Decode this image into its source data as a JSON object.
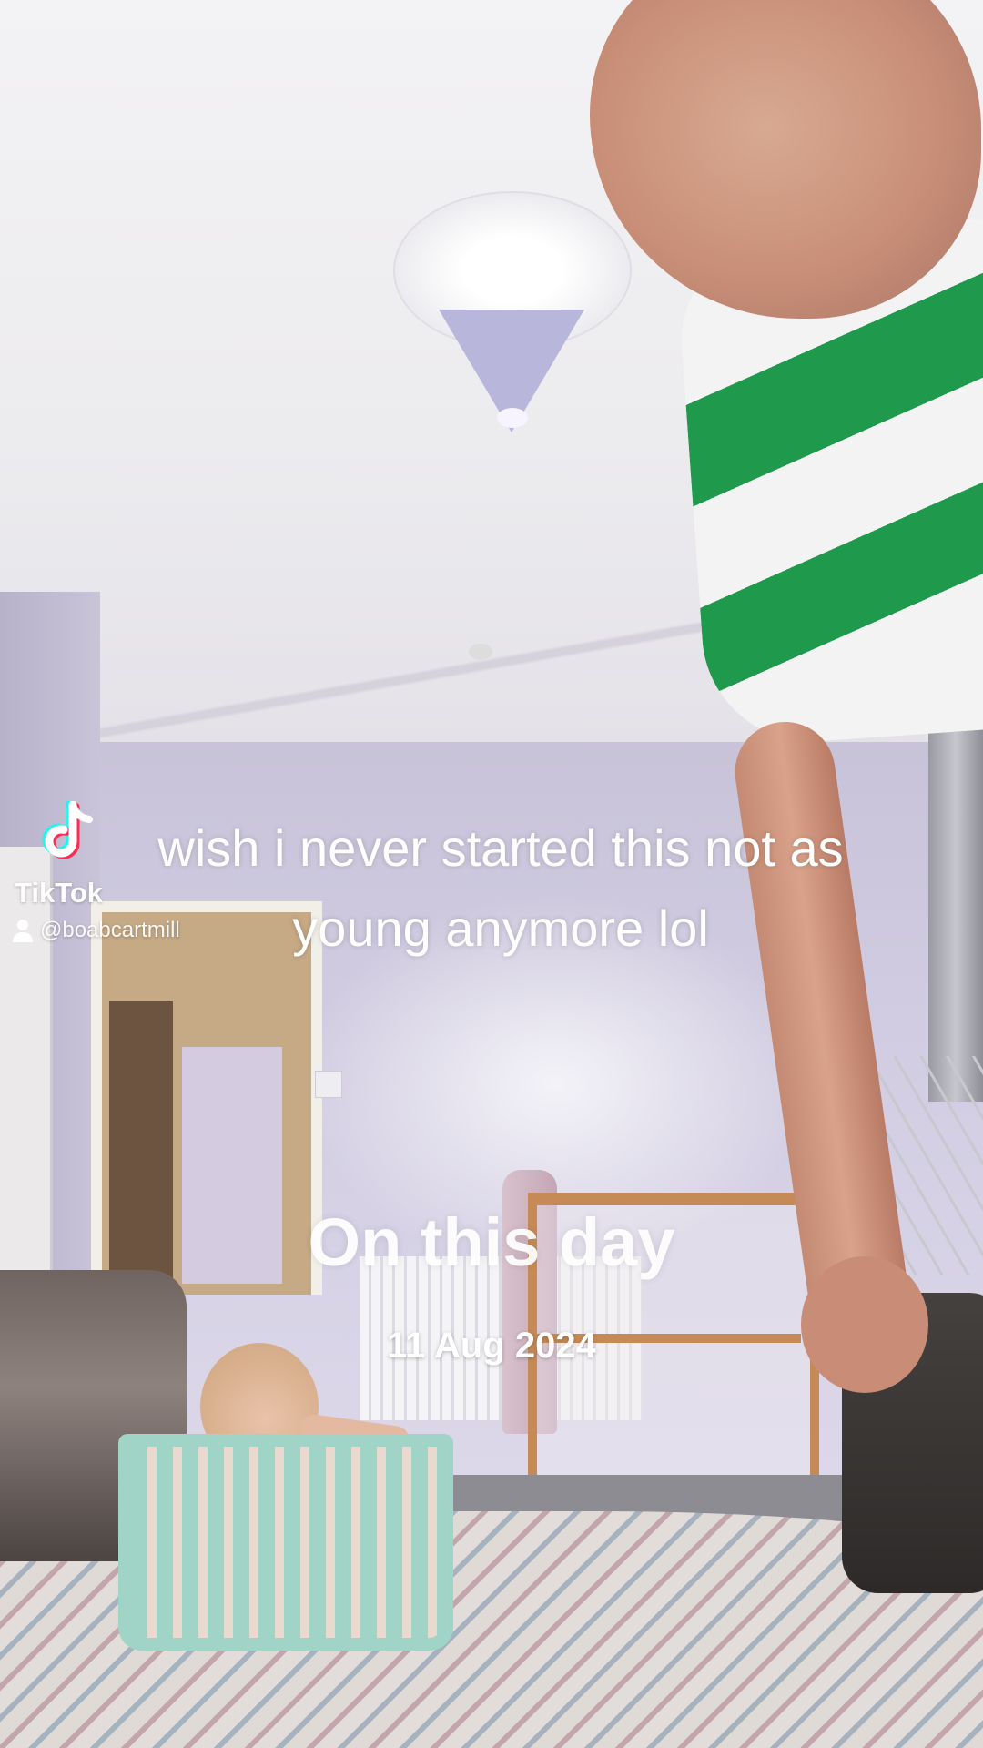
{
  "caption": {
    "text": "wish i never started this not as young anymore lol"
  },
  "watermark": {
    "brand": "TikTok",
    "handle": "@boabcartmill",
    "logo_icon": "tiktok-note-icon",
    "user_icon": "person-icon",
    "logo_colors": [
      "#25f4ee",
      "#fe2c55",
      "#ffffff"
    ]
  },
  "memory": {
    "title": "On this day",
    "date": "11 Aug 2024"
  }
}
